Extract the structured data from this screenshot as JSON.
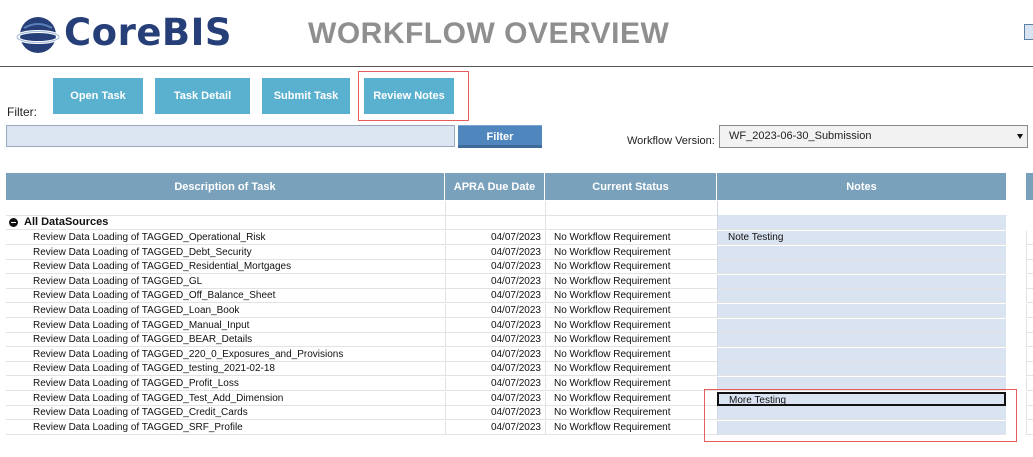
{
  "header": {
    "logo_text": "CoreBIS",
    "page_title": "WORKFLOW OVERVIEW"
  },
  "toolbar": {
    "open_task": "Open Task",
    "task_detail": "Task Detail",
    "submit_task": "Submit Task",
    "review_notes": "Review Notes"
  },
  "filter": {
    "label": "Filter:",
    "value": "",
    "button": "Filter"
  },
  "workflow_version": {
    "label": "Workflow Version:",
    "selected": "WF_2023-06-30_Submission"
  },
  "table": {
    "columns": [
      "Description of Task",
      "APRA Due Date",
      "Current Status",
      "Notes"
    ],
    "group_label": "All DataSources",
    "rows": [
      {
        "desc": "Review Data Loading of TAGGED_Operational_Risk",
        "date": "04/07/2023",
        "status": "No Workflow Requirement",
        "notes": "Note Testing"
      },
      {
        "desc": "Review Data Loading of TAGGED_Debt_Security",
        "date": "04/07/2023",
        "status": "No Workflow Requirement",
        "notes": ""
      },
      {
        "desc": "Review Data Loading of TAGGED_Residential_Mortgages",
        "date": "04/07/2023",
        "status": "No Workflow Requirement",
        "notes": ""
      },
      {
        "desc": "Review Data Loading of TAGGED_GL",
        "date": "04/07/2023",
        "status": "No Workflow Requirement",
        "notes": ""
      },
      {
        "desc": "Review Data Loading of TAGGED_Off_Balance_Sheet",
        "date": "04/07/2023",
        "status": "No Workflow Requirement",
        "notes": ""
      },
      {
        "desc": "Review Data Loading of TAGGED_Loan_Book",
        "date": "04/07/2023",
        "status": "No Workflow Requirement",
        "notes": ""
      },
      {
        "desc": "Review Data Loading of TAGGED_Manual_Input",
        "date": "04/07/2023",
        "status": "No Workflow Requirement",
        "notes": ""
      },
      {
        "desc": "Review Data Loading of TAGGED_BEAR_Details",
        "date": "04/07/2023",
        "status": "No Workflow Requirement",
        "notes": ""
      },
      {
        "desc": "Review Data Loading of TAGGED_220_0_Exposures_and_Provisions",
        "date": "04/07/2023",
        "status": "No Workflow Requirement",
        "notes": ""
      },
      {
        "desc": "Review Data Loading of TAGGED_testing_2021-02-18",
        "date": "04/07/2023",
        "status": "No Workflow Requirement",
        "notes": ""
      },
      {
        "desc": "Review Data Loading of TAGGED_Profit_Loss",
        "date": "04/07/2023",
        "status": "No Workflow Requirement",
        "notes": ""
      },
      {
        "desc": "Review Data Loading of TAGGED_Test_Add_Dimension",
        "date": "04/07/2023",
        "status": "No Workflow Requirement",
        "notes": "More Testing"
      },
      {
        "desc": "Review Data Loading of TAGGED_Credit_Cards",
        "date": "04/07/2023",
        "status": "No Workflow Requirement",
        "notes": ""
      },
      {
        "desc": "Review Data Loading of TAGGED_SRF_Profile",
        "date": "04/07/2023",
        "status": "No Workflow Requirement",
        "notes": ""
      }
    ]
  },
  "icons": {
    "logo": "corebis-logo-icon",
    "collapse": "collapse-minus-icon",
    "dropdown": "chevron-down-icon"
  },
  "colors": {
    "brand": "#273f78",
    "button": "#5ab0cf",
    "header": "#7aa1bb",
    "notes_bg": "#dae3f2",
    "highlight": "#e45c5c"
  }
}
